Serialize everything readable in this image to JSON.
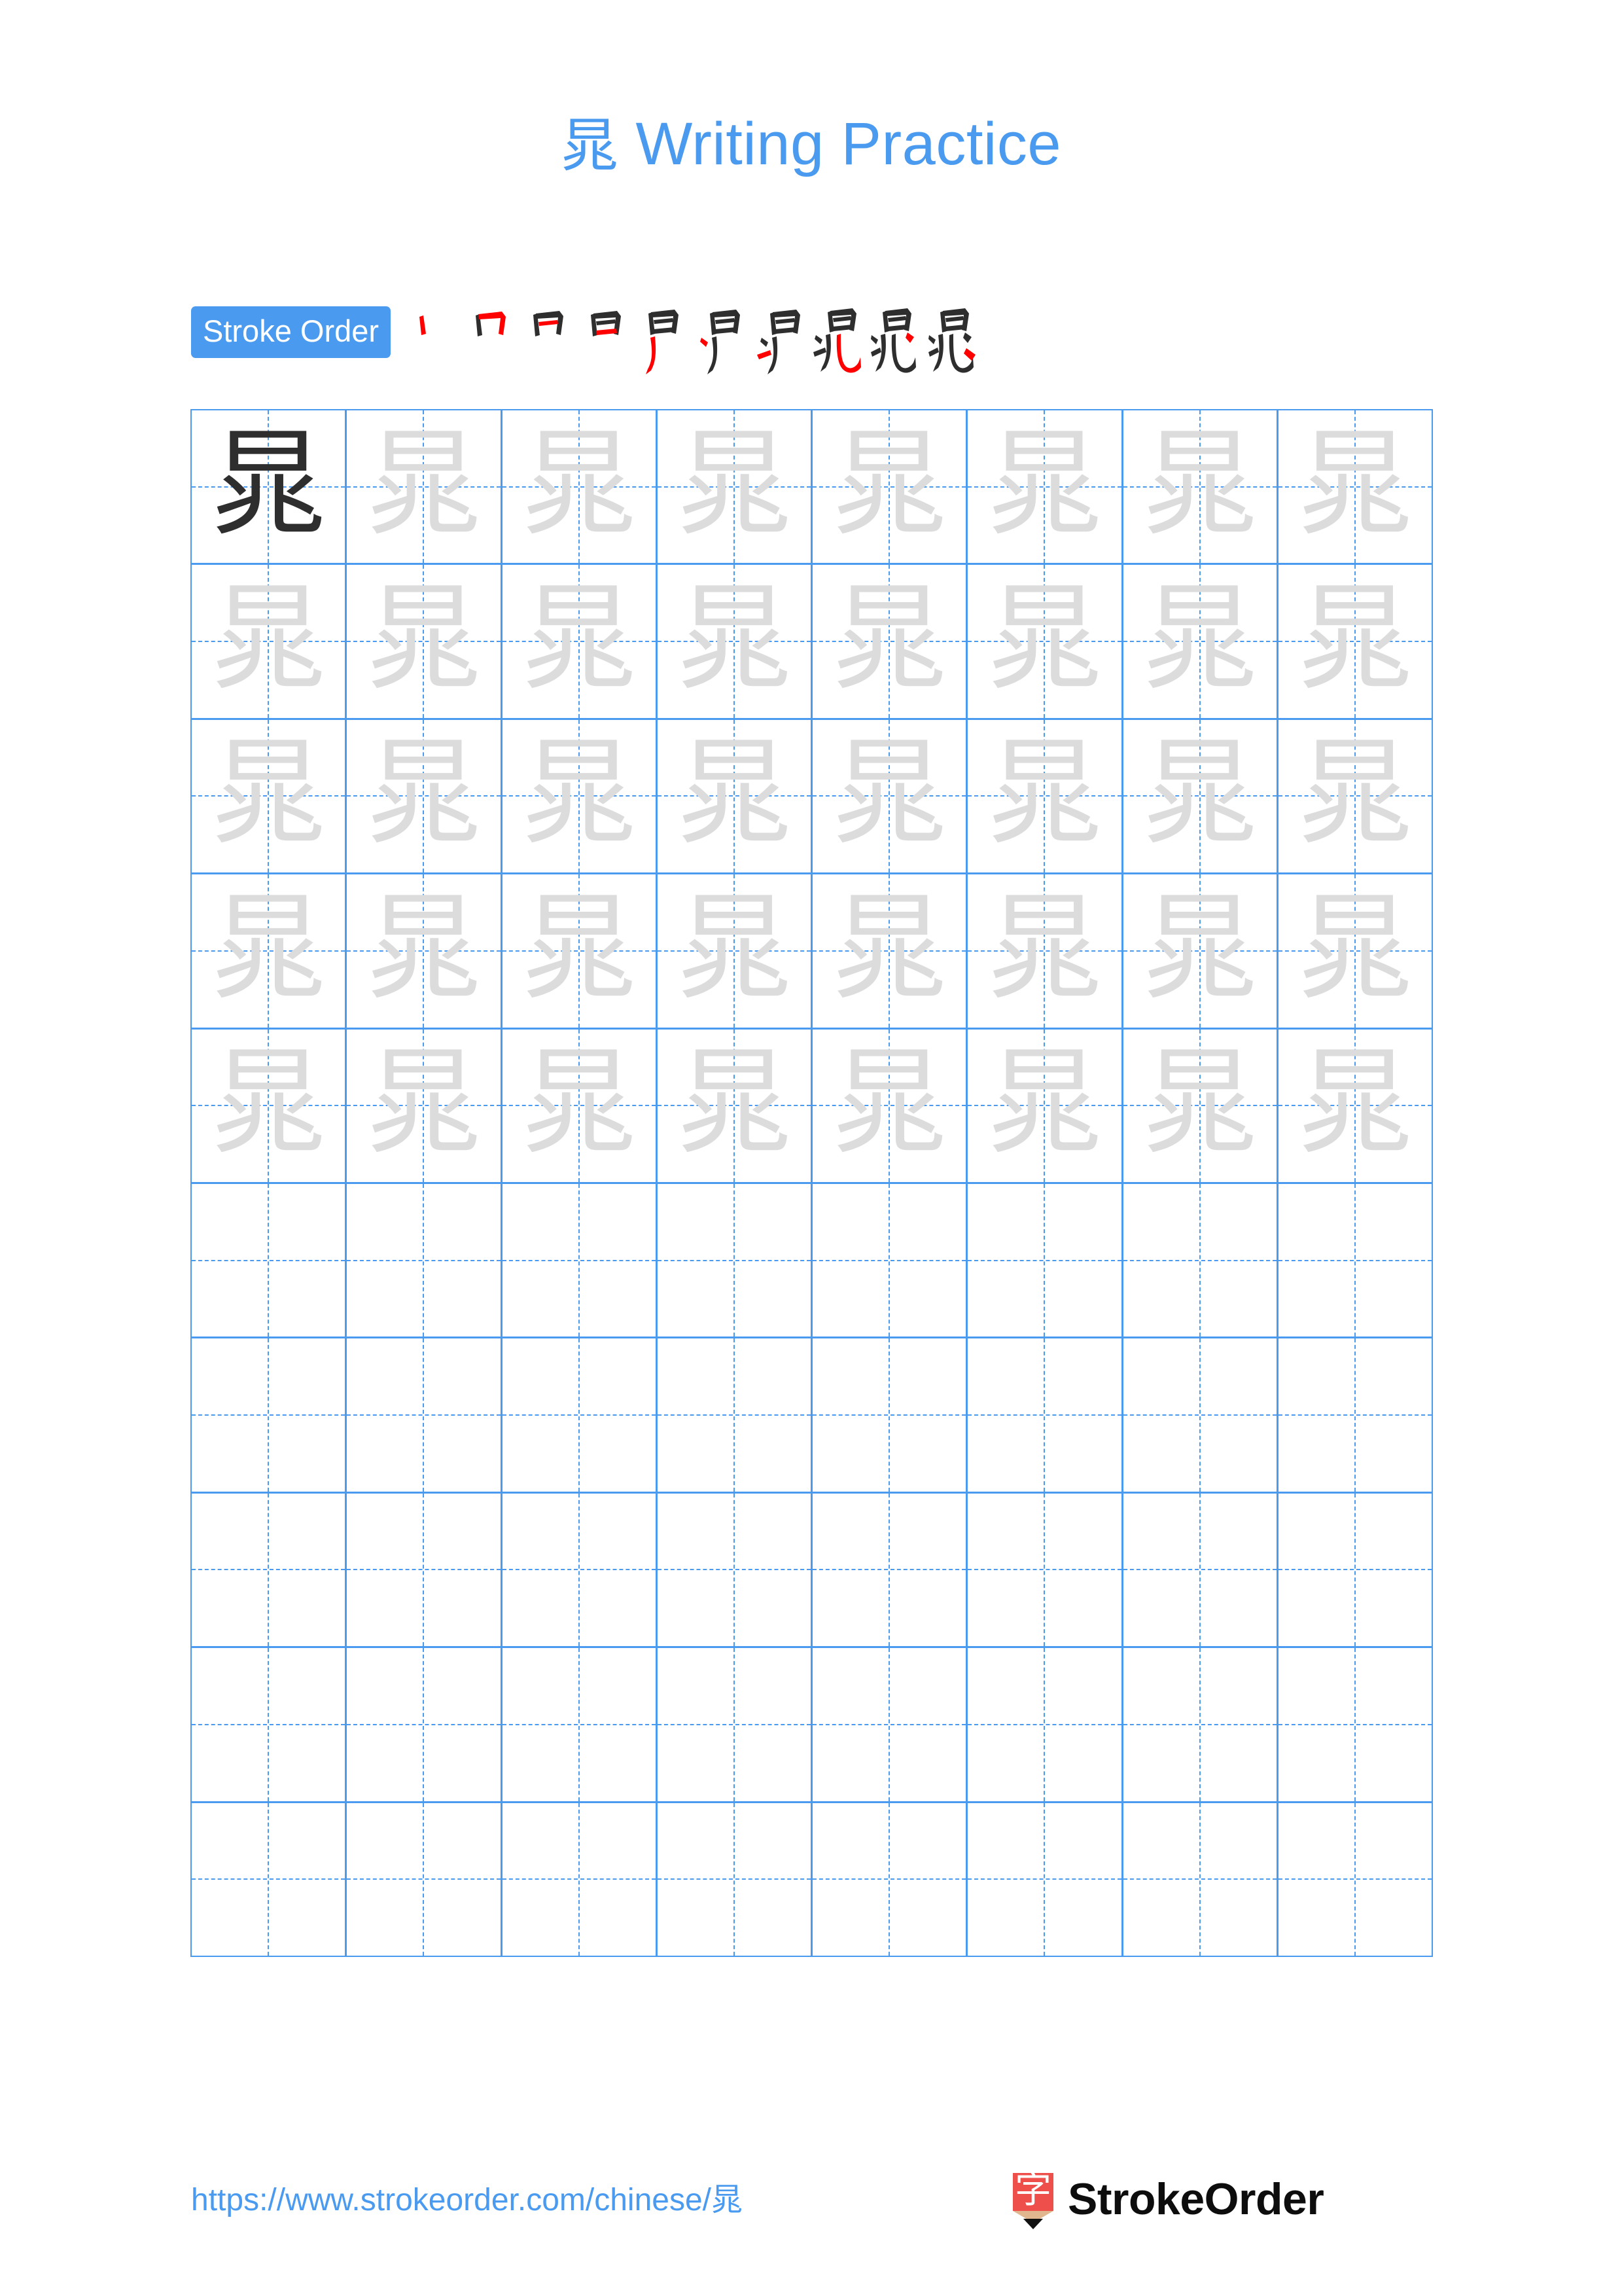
{
  "page": {
    "character": "晁",
    "title_suffix": " Writing Practice",
    "title_full": "晁 Writing Practice",
    "accent_color": "#4a9bf0",
    "grid_line_color": "#4a9bf0",
    "trace_glyph_color": "#dcdcdc",
    "model_glyph_color": "#2e2e2e",
    "new_stroke_color": "#ff0000",
    "drawn_stroke_color": "#2e2e2e"
  },
  "stroke_order": {
    "label": "Stroke Order",
    "total_strokes": 10,
    "steps": [
      {
        "index": 1,
        "name": "stroke-step-1"
      },
      {
        "index": 2,
        "name": "stroke-step-2"
      },
      {
        "index": 3,
        "name": "stroke-step-3"
      },
      {
        "index": 4,
        "name": "stroke-step-4"
      },
      {
        "index": 5,
        "name": "stroke-step-5"
      },
      {
        "index": 6,
        "name": "stroke-step-6"
      },
      {
        "index": 7,
        "name": "stroke-step-7"
      },
      {
        "index": 8,
        "name": "stroke-step-8"
      },
      {
        "index": 9,
        "name": "stroke-step-9"
      },
      {
        "index": 10,
        "name": "stroke-step-10"
      }
    ]
  },
  "practice_grid": {
    "columns": 8,
    "rows": 10,
    "filled_rows": 5,
    "empty_rows": 5,
    "cell_glyph": "晁",
    "rows_data": [
      {
        "row": 1,
        "cells": [
          "晁",
          "晁",
          "晁",
          "晁",
          "晁",
          "晁",
          "晁",
          "晁"
        ],
        "model_cell": 1
      },
      {
        "row": 2,
        "cells": [
          "晁",
          "晁",
          "晁",
          "晁",
          "晁",
          "晁",
          "晁",
          "晁"
        ],
        "model_cell": 0
      },
      {
        "row": 3,
        "cells": [
          "晁",
          "晁",
          "晁",
          "晁",
          "晁",
          "晁",
          "晁",
          "晁"
        ],
        "model_cell": 0
      },
      {
        "row": 4,
        "cells": [
          "晁",
          "晁",
          "晁",
          "晁",
          "晁",
          "晁",
          "晁",
          "晁"
        ],
        "model_cell": 0
      },
      {
        "row": 5,
        "cells": [
          "晁",
          "晁",
          "晁",
          "晁",
          "晁",
          "晁",
          "晁",
          "晁"
        ],
        "model_cell": 0
      },
      {
        "row": 6,
        "cells": [
          "",
          "",
          "",
          "",
          "",
          "",
          "",
          ""
        ],
        "model_cell": 0
      },
      {
        "row": 7,
        "cells": [
          "",
          "",
          "",
          "",
          "",
          "",
          "",
          ""
        ],
        "model_cell": 0
      },
      {
        "row": 8,
        "cells": [
          "",
          "",
          "",
          "",
          "",
          "",
          "",
          ""
        ],
        "model_cell": 0
      },
      {
        "row": 9,
        "cells": [
          "",
          "",
          "",
          "",
          "",
          "",
          "",
          ""
        ],
        "model_cell": 0
      },
      {
        "row": 10,
        "cells": [
          "",
          "",
          "",
          "",
          "",
          "",
          "",
          ""
        ],
        "model_cell": 0
      }
    ]
  },
  "footer": {
    "url": "https://www.strokeorder.com/chinese/晁",
    "brand_name": "StrokeOrder",
    "brand_mark_glyph": "字",
    "brand_mark_color": "#ee4f4a"
  }
}
